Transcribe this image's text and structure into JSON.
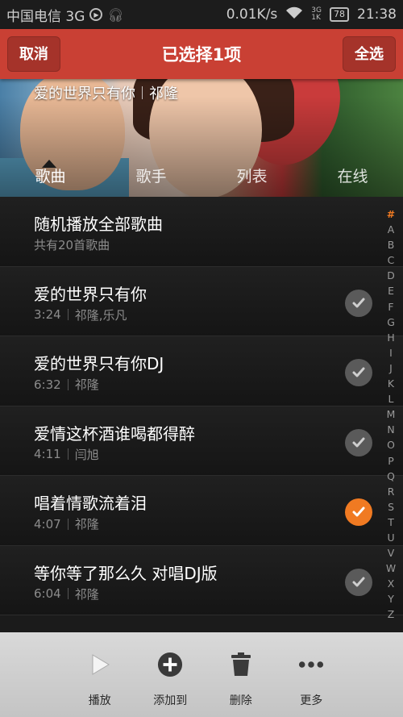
{
  "status_bar": {
    "carrier": "中国电信 3G",
    "net_speed": "0.01K/s",
    "net_type_top": "3G",
    "net_type_bottom": "1K",
    "battery": "78",
    "time": "21:38"
  },
  "header": {
    "title": "已选择1项",
    "cancel_label": "取消",
    "select_all_label": "全选"
  },
  "now_playing": {
    "song": "爱的世界只有你",
    "artist": "祁隆"
  },
  "tabs": [
    {
      "label": "歌曲",
      "active": true
    },
    {
      "label": "歌手",
      "active": false
    },
    {
      "label": "列表",
      "active": false
    },
    {
      "label": "在线",
      "active": false
    }
  ],
  "shuffle": {
    "title": "随机播放全部歌曲",
    "subtitle": "共有20首歌曲"
  },
  "songs": [
    {
      "title": "爱的世界只有你",
      "duration": "3:24",
      "artist": "祁隆,乐凡",
      "selected": false
    },
    {
      "title": "爱的世界只有你DJ",
      "duration": "6:32",
      "artist": "祁隆",
      "selected": false
    },
    {
      "title": "爱情这杯酒谁喝都得醉",
      "duration": "4:11",
      "artist": "闫旭",
      "selected": false
    },
    {
      "title": "唱着情歌流着泪",
      "duration": "4:07",
      "artist": "祁隆",
      "selected": true
    },
    {
      "title": "等你等了那么久 对唱DJ版",
      "duration": "6:04",
      "artist": "祁隆",
      "selected": false
    }
  ],
  "index_letters": [
    "#",
    "A",
    "B",
    "C",
    "D",
    "E",
    "F",
    "G",
    "H",
    "I",
    "J",
    "K",
    "L",
    "M",
    "N",
    "O",
    "P",
    "Q",
    "R",
    "S",
    "T",
    "U",
    "V",
    "W",
    "X",
    "Y",
    "Z"
  ],
  "toolbar": {
    "play_label": "播放",
    "add_label": "添加到",
    "delete_label": "删除",
    "more_label": "更多"
  },
  "colors": {
    "accent_red": "#c94034",
    "selected_orange": "#f07a22",
    "unselected_gray": "#5a5a5a"
  }
}
